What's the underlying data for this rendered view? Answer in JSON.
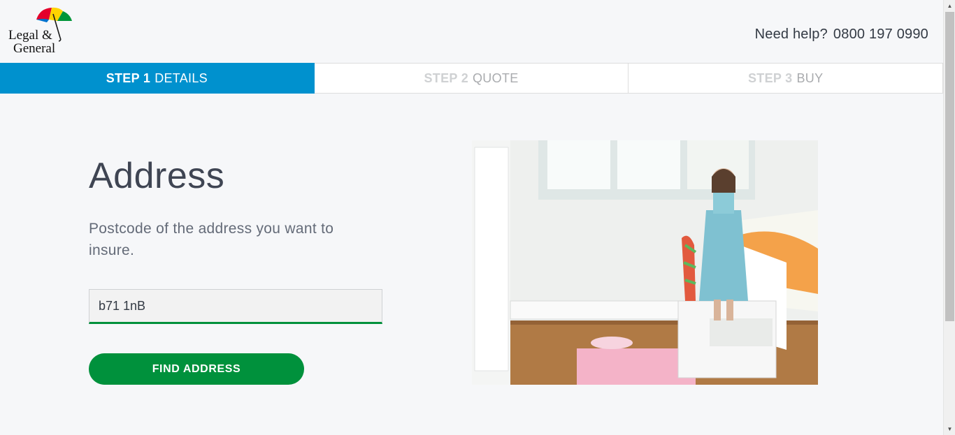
{
  "brand": {
    "line1": "Legal &",
    "line2": "General"
  },
  "header": {
    "help_label": "Need help?",
    "phone": "0800 197 0990"
  },
  "steps": [
    {
      "num": "STEP 1",
      "label": "DETAILS",
      "active": true
    },
    {
      "num": "STEP 2",
      "label": "QUOTE",
      "active": false
    },
    {
      "num": "STEP 3",
      "label": "BUY",
      "active": false
    }
  ],
  "form": {
    "title": "Address",
    "prompt": "Postcode of the address you want to insure.",
    "postcode_value": "b71 1nB",
    "find_button": "FIND ADDRESS"
  },
  "colors": {
    "accent_blue": "#0091ce",
    "accent_green": "#00913c"
  },
  "icons": [
    "umbrella-logo-icon",
    "scroll-up-icon",
    "scroll-down-icon"
  ]
}
